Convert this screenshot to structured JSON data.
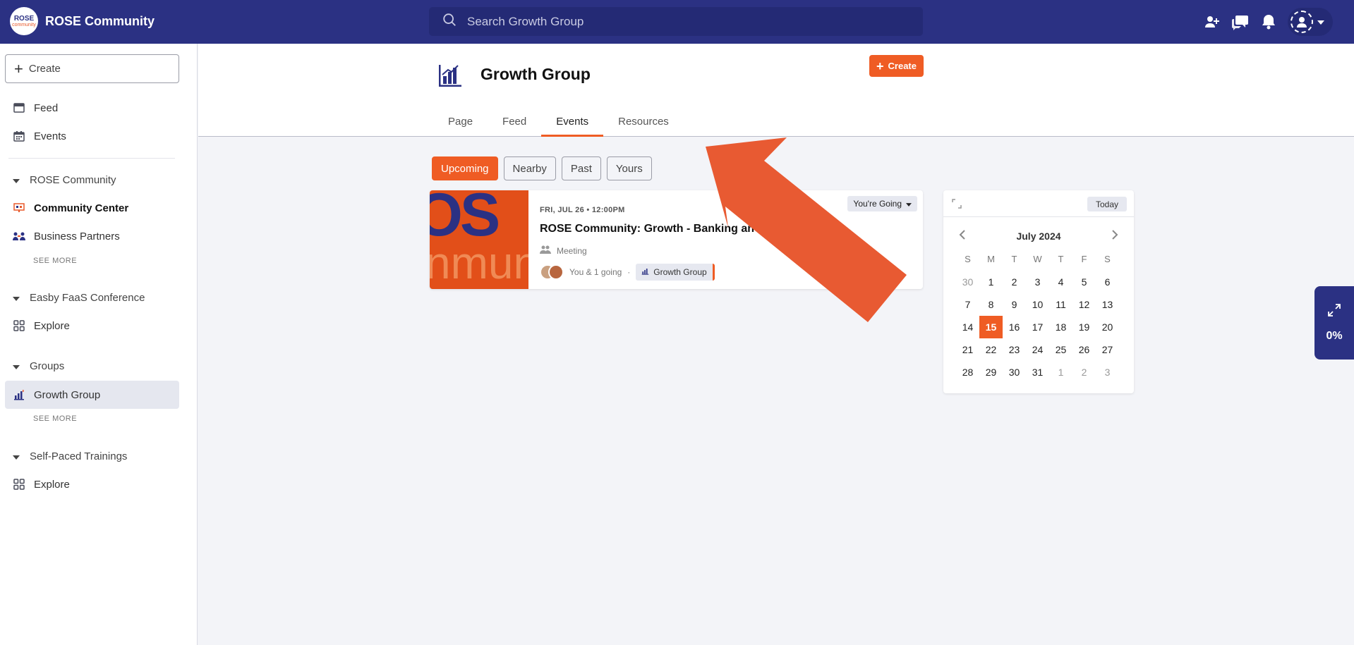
{
  "brand": {
    "logo_top": "ROSE",
    "logo_bottom": "community",
    "name": "ROSE Community"
  },
  "search": {
    "placeholder": "Search Growth Group"
  },
  "sidebar": {
    "create_label": "Create",
    "feed": "Feed",
    "events": "Events",
    "rose_section": "ROSE Community",
    "community_center": "Community Center",
    "business_partners": "Business Partners",
    "see_more_1": "SEE MORE",
    "easby_section": "Easby FaaS Conference",
    "explore_1": "Explore",
    "groups_section": "Groups",
    "growth_group": "Growth Group",
    "see_more_2": "SEE MORE",
    "self_paced_section": "Self-Paced Trainings",
    "explore_2": "Explore"
  },
  "header": {
    "title": "Growth Group",
    "create_label": "Create",
    "tabs": [
      "Page",
      "Feed",
      "Events",
      "Resources"
    ],
    "active_tab": "Events"
  },
  "filters": {
    "items": [
      "Upcoming",
      "Nearby",
      "Past",
      "Yours"
    ],
    "active": "Upcoming"
  },
  "event": {
    "image_text_1": "OS",
    "image_text_2": "nmun",
    "date": "FRI, JUL 26 • 12:00PM",
    "title": "ROSE Community: Growth - Banking an",
    "type": "Meeting",
    "attendance": "You & 1 going",
    "separator": "·",
    "group_tag": "Growth Group",
    "rsvp": "You're Going"
  },
  "calendar": {
    "today_label": "Today",
    "month": "July 2024",
    "weekdays": [
      "S",
      "M",
      "T",
      "W",
      "T",
      "F",
      "S"
    ],
    "selected_day": "15",
    "days": [
      [
        "30",
        "1",
        "2",
        "3",
        "4",
        "5",
        "6"
      ],
      [
        "7",
        "8",
        "9",
        "10",
        "11",
        "12",
        "13"
      ],
      [
        "14",
        "15",
        "16",
        "17",
        "18",
        "19",
        "20"
      ],
      [
        "21",
        "22",
        "23",
        "24",
        "25",
        "26",
        "27"
      ],
      [
        "28",
        "29",
        "30",
        "31",
        "1",
        "2",
        "3"
      ]
    ]
  },
  "progress": {
    "value": "0%"
  },
  "colors": {
    "primary": "#2b3183",
    "accent": "#ef5c24",
    "arrow": "#e85a32"
  }
}
